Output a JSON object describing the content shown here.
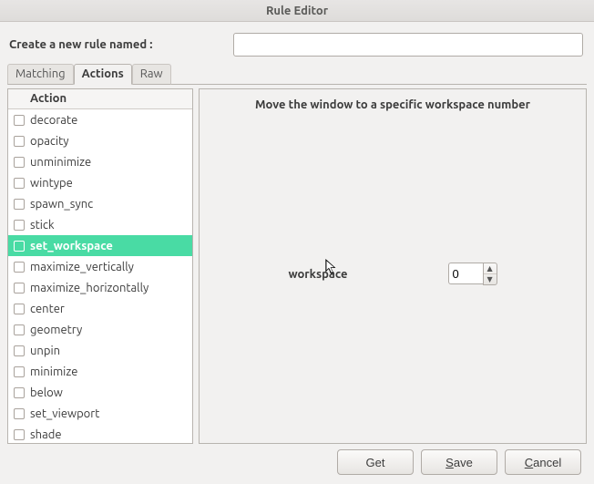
{
  "window": {
    "title": "Rule Editor"
  },
  "name_row": {
    "label": "Create a new rule named :",
    "value": ""
  },
  "tabs": [
    {
      "label": "Matching",
      "active": false
    },
    {
      "label": "Actions",
      "active": true
    },
    {
      "label": "Raw",
      "active": false
    }
  ],
  "list": {
    "header": "Action",
    "selected_index": 6,
    "items": [
      {
        "label": "decorate"
      },
      {
        "label": "opacity"
      },
      {
        "label": "unminimize"
      },
      {
        "label": "wintype"
      },
      {
        "label": "spawn_sync"
      },
      {
        "label": "stick"
      },
      {
        "label": "set_workspace"
      },
      {
        "label": "maximize_vertically"
      },
      {
        "label": "maximize_horizontally"
      },
      {
        "label": "center"
      },
      {
        "label": "geometry"
      },
      {
        "label": "unpin"
      },
      {
        "label": "minimize"
      },
      {
        "label": "below"
      },
      {
        "label": "set_viewport"
      },
      {
        "label": "shade"
      }
    ]
  },
  "detail": {
    "title": "Move the window to a specific workspace number",
    "param_label": "workspace",
    "param_value": "0"
  },
  "buttons": {
    "get": "Get",
    "save_pre": "",
    "save_mn": "S",
    "save_post": "ave",
    "cancel_pre": "",
    "cancel_mn": "C",
    "cancel_post": "ancel"
  }
}
